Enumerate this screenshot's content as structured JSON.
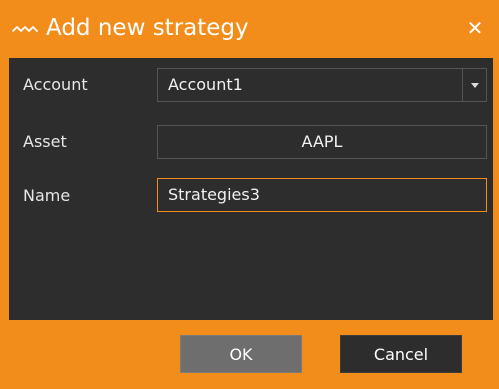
{
  "window": {
    "title": "Add new strategy",
    "title_icon": "wave-icon",
    "close_glyph": "✕"
  },
  "form": {
    "account": {
      "label": "Account",
      "value": "Account1"
    },
    "asset": {
      "label": "Asset",
      "value": "AAPL"
    },
    "name": {
      "label": "Name",
      "value": "Strategies3"
    }
  },
  "buttons": {
    "ok": "OK",
    "cancel": "Cancel"
  },
  "colors": {
    "accent": "#f28c1a",
    "panel": "#2d2d2d",
    "ok_button": "#6e6e6e"
  }
}
